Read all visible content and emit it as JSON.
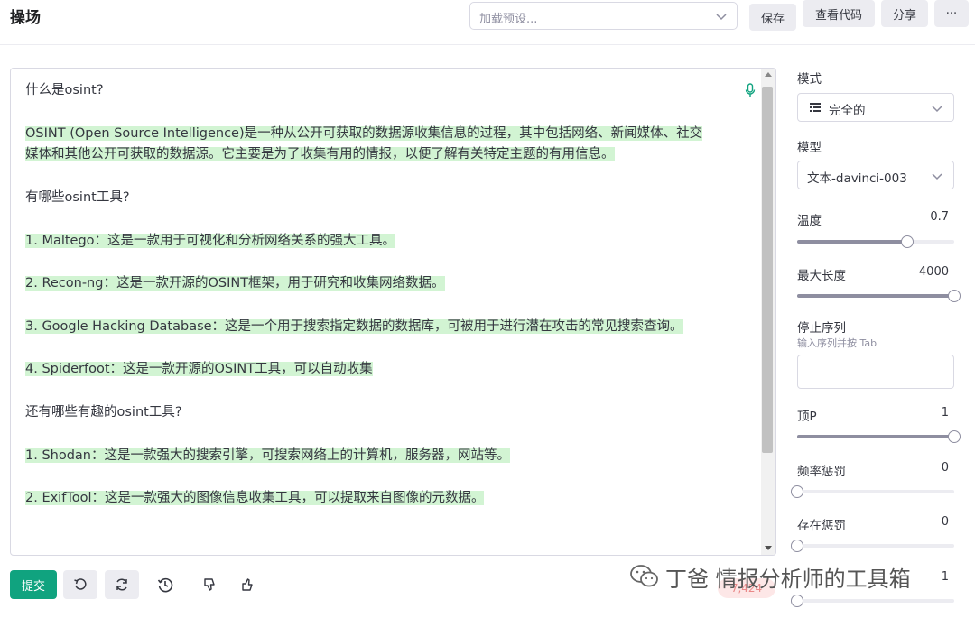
{
  "header": {
    "title": "操场",
    "preset_placeholder": "加载预设...",
    "save_label": "保存",
    "view_code_label": "查看代码",
    "share_label": "分享",
    "more_label": "···"
  },
  "editor": {
    "paragraphs": [
      {
        "text": "什么是osint?",
        "highlight": false
      },
      {
        "text": "OSINT (Open Source Intelligence)是一种从公开可获取的数据源收集信息的过程，其中包括网络、新闻媒体、社交媒体和其他公开可获取的数据源。它主要是为了收集有用的情报，以便了解有关特定主题的有用信息。",
        "highlight": true
      },
      {
        "text": "有哪些osint工具?",
        "highlight": false
      },
      {
        "text": "1. Maltego：这是一款用于可视化和分析网络关系的强大工具。",
        "highlight": true
      },
      {
        "text": "2. Recon-ng：这是一款开源的OSINT框架，用于研究和收集网络数据。",
        "highlight": true
      },
      {
        "text": "3. Google Hacking Database：这是一个用于搜索指定数据的数据库，可被用于进行潜在攻击的常见搜索查询。",
        "highlight": true
      },
      {
        "text": "4. Spiderfoot：这是一款开源的OSINT工具，可以自动收集",
        "highlight": true
      },
      {
        "text": "还有哪些有趣的osint工具?",
        "highlight": false
      },
      {
        "text": "1. Shodan：这是一款强大的搜索引擎，可搜索网络上的计算机，服务器，网站等。",
        "highlight": true
      },
      {
        "text": "2. ExifTool：这是一款强大的图像信息收集工具，可以提取来自图像的元数据。",
        "highlight": true
      }
    ]
  },
  "toolbar": {
    "submit_label": "提交",
    "counter": "7,424"
  },
  "sidebar": {
    "mode_label": "模式",
    "mode_value": "完全的",
    "model_label": "模型",
    "model_value": "文本-davinci-003",
    "temperature_label": "温度",
    "temperature_value": "0.7",
    "temperature_fraction": 0.7,
    "max_length_label": "最大长度",
    "max_length_value": "4000",
    "max_length_fraction": 1.0,
    "stop_label": "停止序列",
    "stop_hint": "输入序列并按 Tab",
    "top_p_label": "顶P",
    "top_p_value": "1",
    "top_p_fraction": 1.0,
    "freq_label": "频率惩罚",
    "freq_value": "0",
    "freq_fraction": 0.0,
    "presence_label": "存在惩罚",
    "presence_value": "0",
    "presence_fraction": 0.0,
    "best_of_value": "1",
    "best_of_fraction": 0.0
  },
  "watermark": {
    "text": "丁爸 情报分析师的工具箱"
  },
  "colors": {
    "accent": "#10a37f",
    "highlight": "#d2f4d3"
  }
}
